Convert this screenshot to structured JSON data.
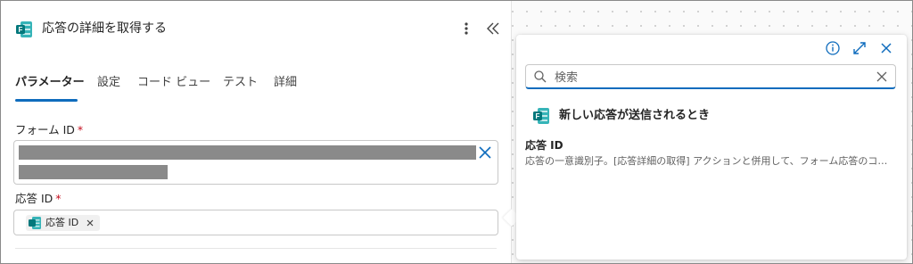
{
  "header": {
    "title": "応答の詳細を取得する"
  },
  "tabs": [
    {
      "label": "パラメーター",
      "active": true
    },
    {
      "label": "設定"
    },
    {
      "label": "コード ビュー"
    },
    {
      "label": "テスト"
    },
    {
      "label": "詳細"
    }
  ],
  "fields": {
    "form_id": {
      "label": "フォーム ID",
      "required_mark": "*"
    },
    "response_id": {
      "label": "応答 ID",
      "required_mark": "*",
      "token_label": "応答 ID"
    }
  },
  "popover": {
    "search": {
      "placeholder": "検索",
      "value": ""
    },
    "trigger": {
      "label": "新しい応答が送信されるとき"
    },
    "items": [
      {
        "name": "応答 ID",
        "description": "応答の一意識別子。[応答詳細の取得] アクションと併用して、フォーム応答のコン..."
      }
    ]
  },
  "colors": {
    "accent": "#0f6cbd",
    "forms_teal": "#03787c",
    "required": "#c50f1f"
  },
  "icons": [
    "forms-icon",
    "more-vertical-icon",
    "collapse-left-icon",
    "info-icon",
    "expand-icon",
    "close-icon",
    "search-icon",
    "clear-icon"
  ]
}
